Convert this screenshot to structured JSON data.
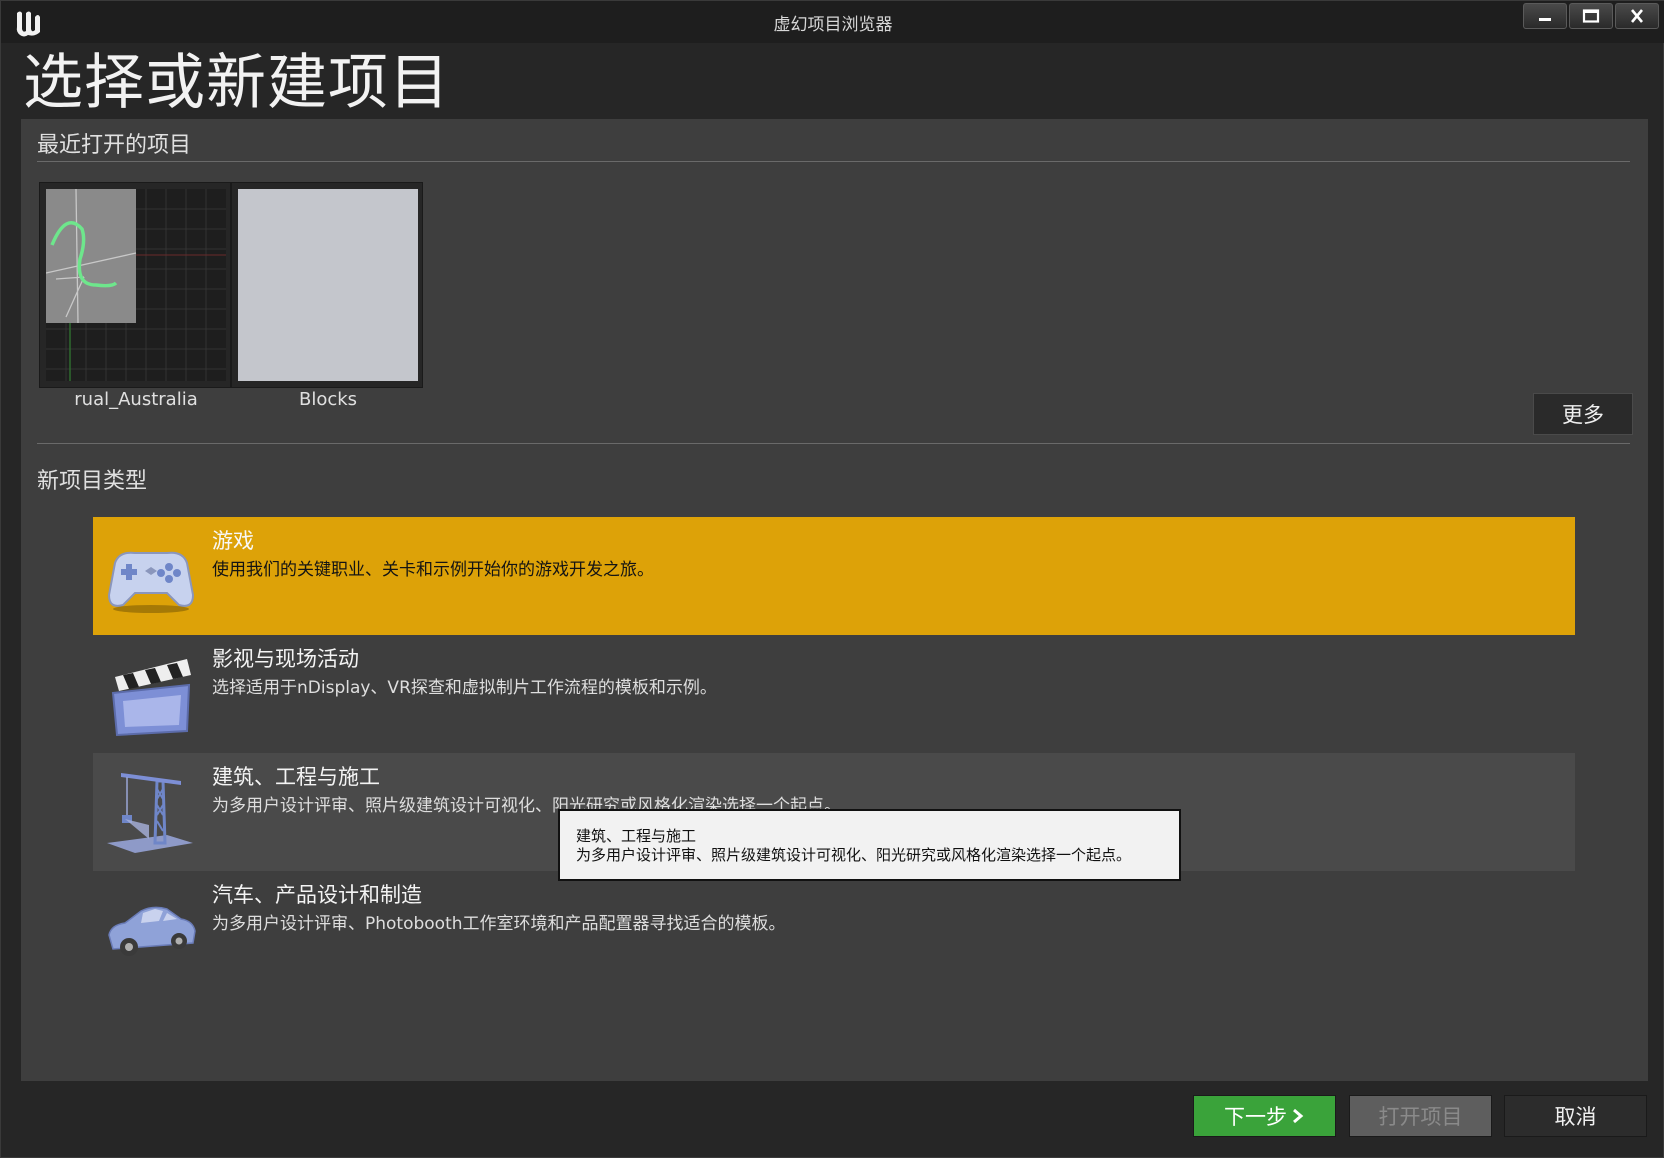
{
  "window": {
    "title": "虚幻项目浏览器",
    "controls": [
      "minimize-icon",
      "maximize-icon",
      "close-icon"
    ]
  },
  "page_title": "选择或新建项目",
  "recent": {
    "label": "最近打开的项目",
    "projects": [
      {
        "name": "rual_Australia",
        "thumbnail": "map-grid-thumbnail"
      },
      {
        "name": "Blocks",
        "thumbnail": "blank-thumbnail"
      }
    ],
    "more_label": "更多"
  },
  "new_project": {
    "label": "新项目类型",
    "categories": [
      {
        "title": "游戏",
        "desc": "使用我们的关键职业、关卡和示例开始你的游戏开发之旅。",
        "icon": "gamepad-icon",
        "state": "selected"
      },
      {
        "title": "影视与现场活动",
        "desc": "选择适用于nDisplay、VR探查和虚拟制片工作流程的模板和示例。",
        "icon": "clapperboard-icon",
        "state": "normal"
      },
      {
        "title": "建筑、工程与施工",
        "desc": "为多用户设计评审、照片级建筑设计可视化、阳光研究或风格化渲染选择一个起点。",
        "icon": "crane-icon",
        "state": "hover"
      },
      {
        "title": "汽车、产品设计和制造",
        "desc": "为多用户设计评审、Photobooth工作室环境和产品配置器寻找适合的模板。",
        "icon": "car-icon",
        "state": "normal"
      }
    ]
  },
  "tooltip": {
    "title": "建筑、工程与施工",
    "desc": "为多用户设计评审、照片级建筑设计可视化、阳光研究或风格化渲染选择一个起点。"
  },
  "buttons": {
    "next": "下一步",
    "open": "打开项目",
    "cancel": "取消"
  },
  "colors": {
    "selected": "#dda208",
    "next_button": "#3aa33a",
    "panel": "#3e3e3e",
    "background": "#262626"
  }
}
